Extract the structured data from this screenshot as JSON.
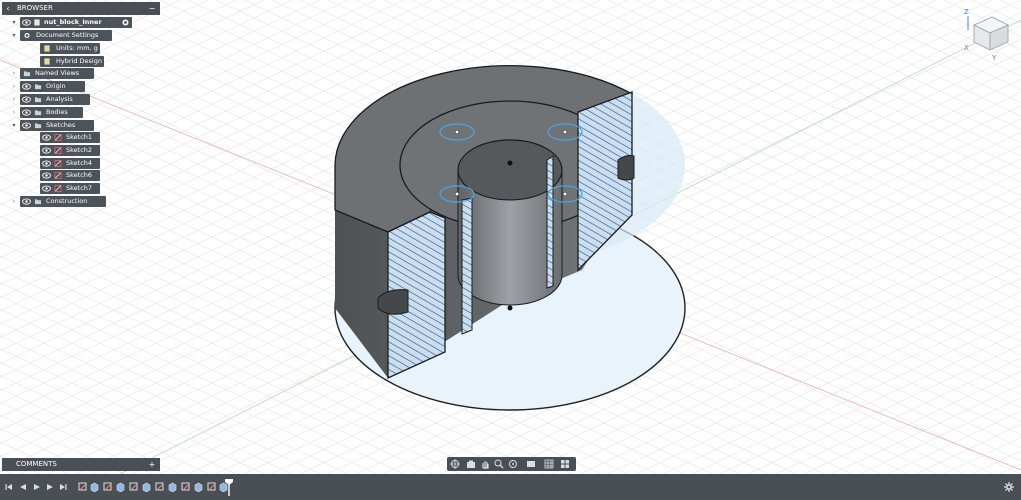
{
  "browser": {
    "title": "BROWSER",
    "document": "nut_block_Inner",
    "items": [
      {
        "label": "Document Settings"
      },
      {
        "label": "Units: mm, g"
      },
      {
        "label": "Hybrid Design"
      },
      {
        "label": "Named Views"
      },
      {
        "label": "Origin"
      },
      {
        "label": "Analysis"
      },
      {
        "label": "Bodies"
      },
      {
        "label": "Sketches"
      },
      {
        "label": "Sketch1"
      },
      {
        "label": "Sketch2"
      },
      {
        "label": "Sketch4"
      },
      {
        "label": "Sketch6"
      },
      {
        "label": "Sketch7"
      },
      {
        "label": "Construction"
      }
    ]
  },
  "comments": {
    "title": "COMMENTS"
  },
  "viewcube": {
    "axis_z": "Z",
    "axis_x": "X",
    "axis_y": "Y"
  },
  "colors": {
    "panel": "#4a4f56",
    "item": "#4d535b",
    "section": "#cfe3f2",
    "body": "#6b6f72",
    "accent": "#4aa3df"
  },
  "icons": [
    "eye-icon",
    "folder-icon",
    "gear-icon",
    "sketch-icon",
    "orbit-icon",
    "pan-icon",
    "zoom-icon",
    "display-icon",
    "grid-icon",
    "play-icon",
    "settings-icon"
  ]
}
